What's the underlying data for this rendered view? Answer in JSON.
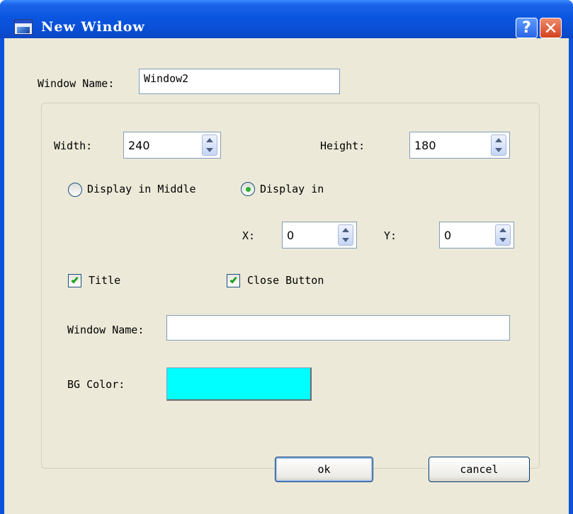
{
  "window": {
    "title": "New Window",
    "help_glyph": "?",
    "close_glyph": "✕"
  },
  "form": {
    "window_name_label": "Window Name:",
    "window_name_value": "Window2",
    "width_label": "Width:",
    "width_value": "240",
    "height_label": "Height:",
    "height_value": "180",
    "display_middle_label": "Display in Middle",
    "display_in_label": "Display in",
    "display_selected": "Display in",
    "x_label": "X:",
    "x_value": "0",
    "y_label": "Y:",
    "y_value": "0",
    "title_label": "Title",
    "title_checked": true,
    "close_button_label": "Close Button",
    "close_button_checked": true,
    "inner_window_name_label": "Window Name:",
    "inner_window_name_value": "",
    "bg_color_label": "BG Color:",
    "bg_color": "#00ffff"
  },
  "buttons": {
    "ok": "ok",
    "cancel": "cancel"
  }
}
